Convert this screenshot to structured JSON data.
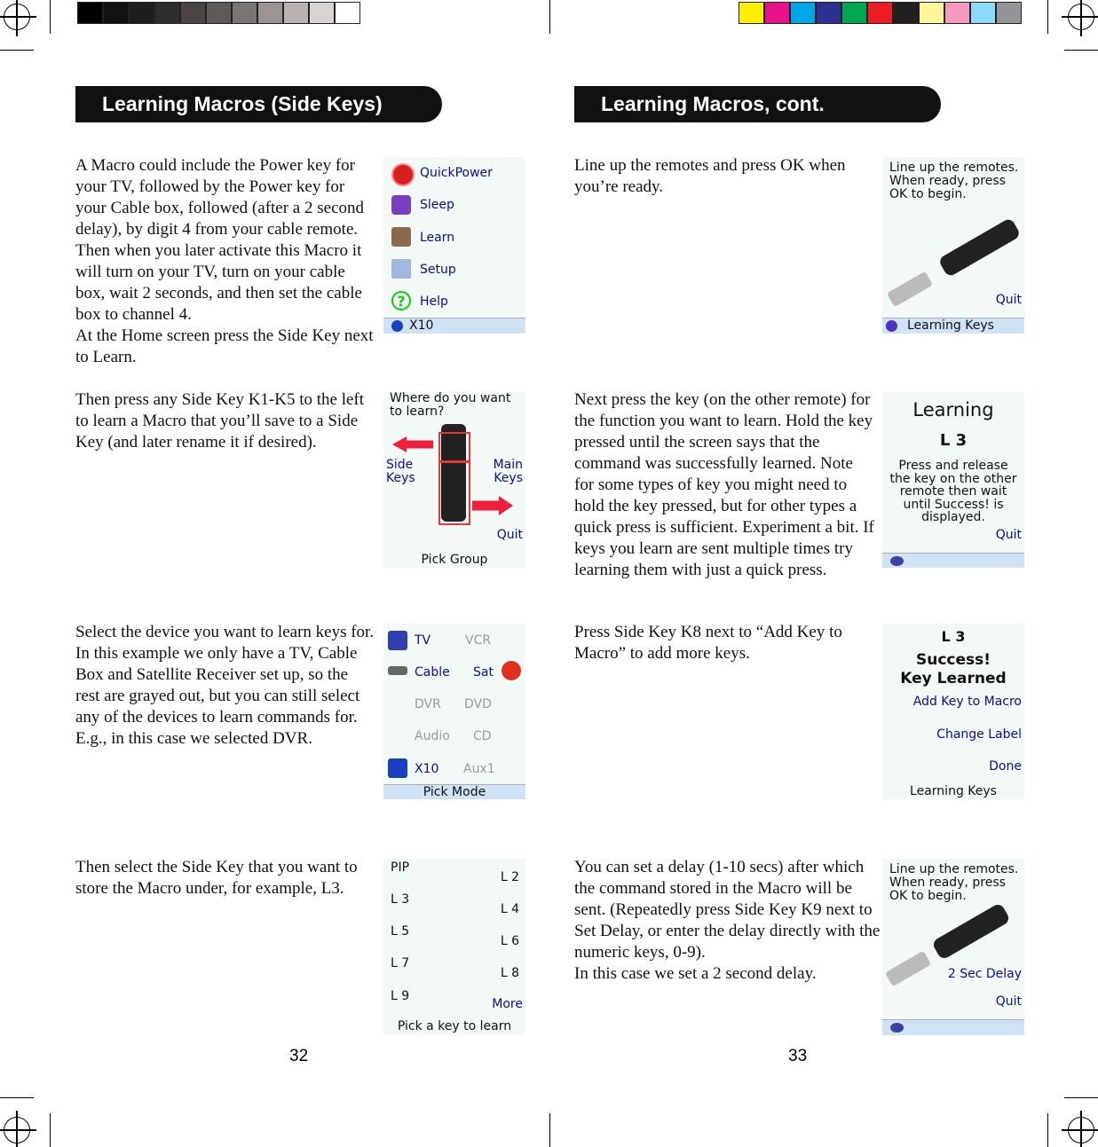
{
  "calibration": {
    "grays": [
      "#000000",
      "#111111",
      "#1e1e1e",
      "#2d2d2d",
      "#4a4444",
      "#5e5a5a",
      "#7a7676",
      "#9a9494",
      "#b8b2b2",
      "#d8d4d4",
      "#ffffff"
    ],
    "colors": [
      "#ffee00",
      "#e8118a",
      "#00a5e6",
      "#2e3192",
      "#00a651",
      "#ed1c24",
      "#231f20",
      "#fff799",
      "#f49ac1",
      "#8ed8f8",
      "#939598"
    ]
  },
  "left": {
    "title": "Learning Macros (Side Keys)",
    "page_number": "32",
    "paragraphs": [
      "A Macro could include the Power key for your TV, followed by the Power key for your Cable box, followed (after a 2 second delay), by digit 4 from your cable remote. Then when you later activate this Macro it will turn on your TV, turn on your cable box, wait 2 seconds, and then set the cable box to channel 4.\nAt the Home screen press the Side Key next to Learn.",
      "Then press any Side Key K1-K5 to the left to learn a Macro that you’ll save to a Side Key (and later rename it if desired).",
      "Select the device you want to learn keys for. In this example we only have a TV, Cable Box and Satellite Receiver set up, so the rest are grayed out, but you can still select any of the devices to learn commands for. E.g., in this case we selected DVR.",
      "Then select the Side Key that you want to store the Macro under, for example, L3."
    ]
  },
  "right": {
    "title": "Learning Macros, cont.",
    "page_number": "33",
    "paragraphs": [
      "Line up the remotes and press OK when you’re ready.",
      "Next press the key (on the other remote) for the function you want to learn. Hold the key pressed until the screen says that the command was successfully learned. Note for some types of key you might need to hold the key pressed, but for other types a quick press is sufficient. Experiment a bit. If keys you learn are sent multiple times try learning them with just a quick press.",
      "Press Side Key K8 next to “Add Key to Macro” to add more keys.",
      "You can set a delay (1-10 secs) after which the command stored in the Macro will be sent. (Repeatedly press Side Key K9 next to Set Delay, or enter the delay directly with the numeric keys, 0-9).\nIn this case we set a 2 second delay."
    ]
  },
  "screens": {
    "home": {
      "items": [
        "QuickPower",
        "Sleep",
        "Learn",
        "Setup",
        "Help"
      ],
      "icons": [
        "power-icon",
        "sleep-icon",
        "learn-icon",
        "setup-icon",
        "help-icon"
      ],
      "bar": "X10"
    },
    "pick_group": {
      "prompt": "Where do you want\nto learn?",
      "side": "Side\nKeys",
      "main": "Main\nKeys",
      "quit": "Quit",
      "footer": "Pick Group"
    },
    "pick_mode": {
      "left": [
        "TV",
        "Cable",
        "DVR",
        "Audio",
        "X10"
      ],
      "right": [
        "VCR",
        "Sat",
        "DVD",
        "CD",
        "Aux1"
      ],
      "bar": "Pick Mode"
    },
    "pick_key": {
      "left": [
        "PIP",
        "L 3",
        "L 5",
        "L 7",
        "L 9"
      ],
      "right": [
        "L 2",
        "L 4",
        "L 6",
        "L 8",
        "More"
      ],
      "footer": "Pick a key to learn"
    },
    "line_up": {
      "prompt": "Line up the remotes.\nWhen ready, press\nOK to begin.",
      "quit": "Quit",
      "bar": "Learning Keys"
    },
    "learning": {
      "title": "Learning",
      "key": "L 3",
      "message": "Press and release\nthe key on the other\nremote then wait\nuntil Success! is\ndisplayed.",
      "quit": "Quit"
    },
    "success": {
      "key": "L 3",
      "line1": "Success!",
      "line2": "Key Learned",
      "add": "Add Key to Macro",
      "change": "Change Label",
      "done": "Done",
      "footer": "Learning Keys"
    },
    "delay": {
      "prompt": "Line up the remotes.\nWhen ready, press\nOK to begin.",
      "delay": "2 Sec Delay",
      "quit": "Quit"
    }
  }
}
